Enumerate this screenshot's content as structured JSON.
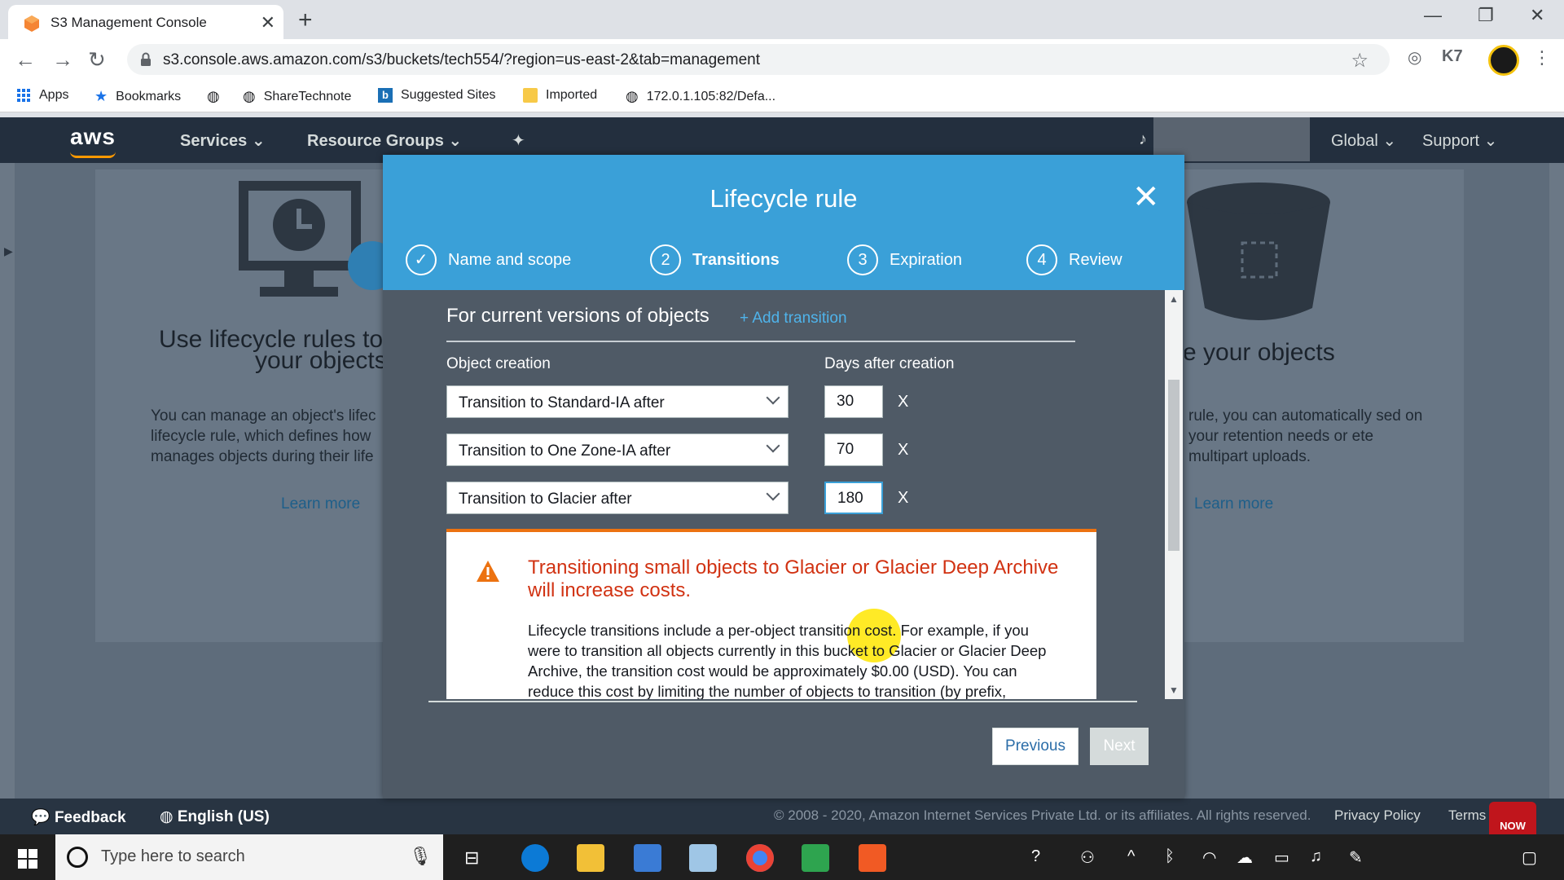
{
  "browser": {
    "tab_title": "S3 Management Console",
    "tab_close": "✕",
    "new_tab": "+",
    "url": "s3.console.aws.amazon.com/s3/buckets/tech554/?region=us-east-2&tab=management",
    "window_controls": {
      "minimize": "—",
      "restore": "❐",
      "close": "✕"
    },
    "bookmarks": [
      "Apps",
      "Bookmarks",
      "ShareTechnote",
      "Suggested Sites",
      "Imported",
      "172.0.1.105:82/Defa..."
    ],
    "extension_label": "K7"
  },
  "aws_header": {
    "logo": "aws",
    "services": "Services",
    "resource_groups": "Resource Groups",
    "global": "Global",
    "support": "Support"
  },
  "background": {
    "left_heading_1": "Use lifecycle rules to",
    "left_heading_2": "your objects",
    "left_para": "You can manage an object's lifec lifecycle rule, which defines how manages objects during their life",
    "left_link": "Learn more",
    "right_heading": "re your objects",
    "right_para": "rule, you can automatically sed on your retention needs or ete multipart uploads.",
    "right_link": "Learn more"
  },
  "modal": {
    "title": "Lifecycle rule",
    "close": "✕",
    "steps": [
      {
        "num": "✓",
        "label": "Name and scope"
      },
      {
        "num": "2",
        "label": "Transitions"
      },
      {
        "num": "3",
        "label": "Expiration"
      },
      {
        "num": "4",
        "label": "Review"
      }
    ],
    "section_title": "For current versions of objects",
    "add_transition": "+ Add transition",
    "col_object_creation": "Object creation",
    "col_days": "Days after creation",
    "transitions": [
      {
        "type": "Transition to Standard-IA after",
        "days": "30",
        "remove": "X"
      },
      {
        "type": "Transition to One Zone-IA after",
        "days": "70",
        "remove": "X"
      },
      {
        "type": "Transition to Glacier after",
        "days": "180",
        "remove": "X"
      }
    ],
    "warning_title": "Transitioning small objects to Glacier or Glacier Deep Archive will increase costs.",
    "warning_body": "Lifecycle transitions include a per-object transition cost. For example, if you were to transition all objects currently in this bucket to Glacier or Glacier Deep Archive, the transition cost would be approximately $0.00 (USD). You can reduce this cost by limiting the number of objects to transition (by prefix,",
    "previous": "Previous",
    "next": "Next"
  },
  "footer": {
    "feedback": "Feedback",
    "language": "English (US)",
    "copyright": "© 2008 - 2020, Amazon Internet Services Private Ltd. or its affiliates. All rights reserved.",
    "privacy": "Privacy Policy",
    "terms": "Terms"
  },
  "taskbar": {
    "search_placeholder": "Type here to search",
    "badge": "NOW"
  },
  "colors": {
    "modal_header": "#3aa0d8",
    "warning_accent": "#ec7211",
    "warning_text": "#d13212",
    "aws_header": "#232f3e",
    "link": "#4fb3ea"
  }
}
